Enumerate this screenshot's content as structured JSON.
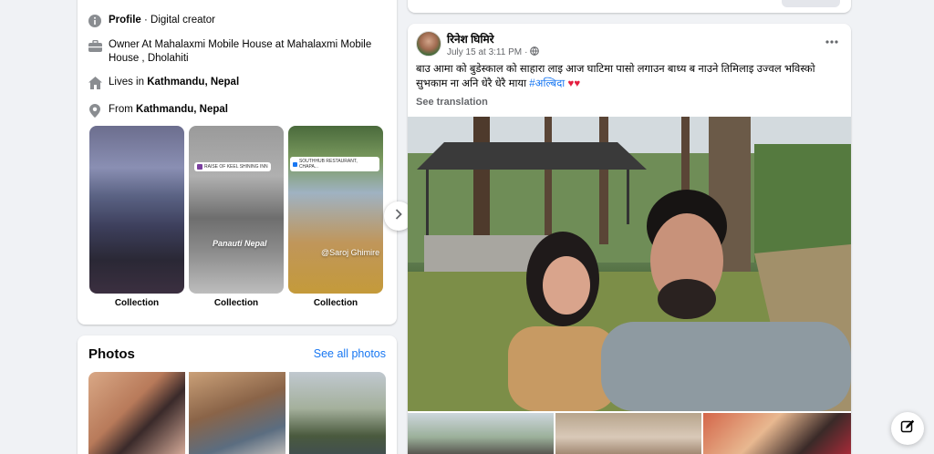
{
  "intro": {
    "profile_label": "Profile",
    "profile_value": "· Digital creator",
    "work_prefix": "Owner At Mahalaxmi Mobile House at Mahalaxmi Mobile House , Dholahiti",
    "lives_prefix": "Lives in ",
    "lives_place": "Kathmandu, Nepal",
    "from_prefix": "From ",
    "from_place": "Kathmandu, Nepal",
    "highlights": [
      {
        "label": "Collection"
      },
      {
        "label": "Collection",
        "overlay": "Panauti Nepal",
        "sticker": "RAISE OF KEEL SHINING INN"
      },
      {
        "label": "Collection",
        "overlay": "@Saroj Ghimire",
        "sticker": "SOUTHHUB RESTAURANT, CHAPA..."
      }
    ]
  },
  "photos": {
    "title": "Photos",
    "see_all": "See all photos"
  },
  "post": {
    "author": "रिनेश घिमिरे",
    "date": "July 15 at 3:11 PM",
    "separator": "·",
    "text": "बाउ आमा को बुडेस्काल को साहारा लाइ आज घाटिमा पासो लगाउन बाध्य ब नाउने तिमिलाइ उज्वल भविस्को सुभकाम ना अनि धेरै धेरै माया ",
    "hashtag": "#अल्बिदा",
    "hearts": "♥♥",
    "see_translation": "See translation"
  },
  "icons": {
    "profile": "info-icon",
    "work": "briefcase-icon",
    "lives": "home-icon",
    "from": "location-pin-icon",
    "privacy": "globe-icon",
    "more": "more-icon",
    "next": "chevron-right-icon",
    "compose": "compose-icon"
  },
  "colors": {
    "link": "#1877f2",
    "background": "#f0f2f5",
    "heart": "#e41e3f"
  }
}
